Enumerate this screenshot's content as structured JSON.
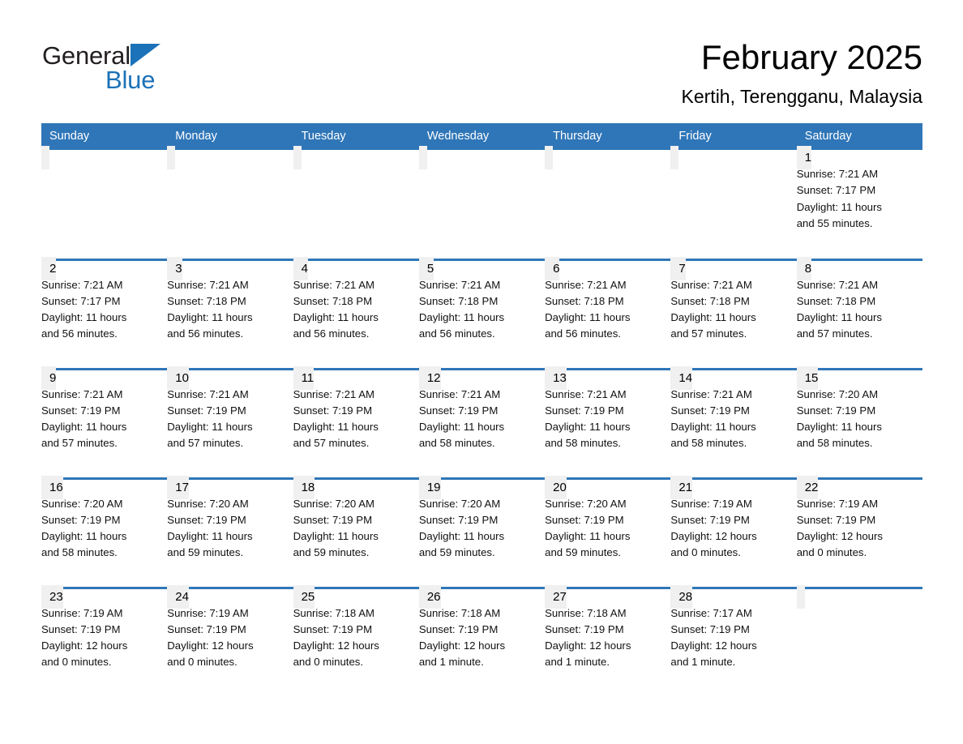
{
  "brand": {
    "name_dark": "General",
    "name_light": "Blue",
    "triangle_color": "#1b72b8"
  },
  "header": {
    "title": "February 2025",
    "subtitle": "Kertih, Terengganu, Malaysia"
  },
  "theme": {
    "header_blue": "#2f76b8",
    "daynum_gray": "#f0f0f0",
    "text_black": "#000000"
  },
  "calendar": {
    "weekday_headers": [
      "Sunday",
      "Monday",
      "Tuesday",
      "Wednesday",
      "Thursday",
      "Friday",
      "Saturday"
    ],
    "weeks": [
      [
        {
          "day": "",
          "sunrise": "",
          "sunset": "",
          "daylight": "",
          "daylight2": ""
        },
        {
          "day": "",
          "sunrise": "",
          "sunset": "",
          "daylight": "",
          "daylight2": ""
        },
        {
          "day": "",
          "sunrise": "",
          "sunset": "",
          "daylight": "",
          "daylight2": ""
        },
        {
          "day": "",
          "sunrise": "",
          "sunset": "",
          "daylight": "",
          "daylight2": ""
        },
        {
          "day": "",
          "sunrise": "",
          "sunset": "",
          "daylight": "",
          "daylight2": ""
        },
        {
          "day": "",
          "sunrise": "",
          "sunset": "",
          "daylight": "",
          "daylight2": ""
        },
        {
          "day": "1",
          "sunrise": "Sunrise: 7:21 AM",
          "sunset": "Sunset: 7:17 PM",
          "daylight": "Daylight: 11 hours",
          "daylight2": "and 55 minutes."
        }
      ],
      [
        {
          "day": "2",
          "sunrise": "Sunrise: 7:21 AM",
          "sunset": "Sunset: 7:17 PM",
          "daylight": "Daylight: 11 hours",
          "daylight2": "and 56 minutes."
        },
        {
          "day": "3",
          "sunrise": "Sunrise: 7:21 AM",
          "sunset": "Sunset: 7:18 PM",
          "daylight": "Daylight: 11 hours",
          "daylight2": "and 56 minutes."
        },
        {
          "day": "4",
          "sunrise": "Sunrise: 7:21 AM",
          "sunset": "Sunset: 7:18 PM",
          "daylight": "Daylight: 11 hours",
          "daylight2": "and 56 minutes."
        },
        {
          "day": "5",
          "sunrise": "Sunrise: 7:21 AM",
          "sunset": "Sunset: 7:18 PM",
          "daylight": "Daylight: 11 hours",
          "daylight2": "and 56 minutes."
        },
        {
          "day": "6",
          "sunrise": "Sunrise: 7:21 AM",
          "sunset": "Sunset: 7:18 PM",
          "daylight": "Daylight: 11 hours",
          "daylight2": "and 56 minutes."
        },
        {
          "day": "7",
          "sunrise": "Sunrise: 7:21 AM",
          "sunset": "Sunset: 7:18 PM",
          "daylight": "Daylight: 11 hours",
          "daylight2": "and 57 minutes."
        },
        {
          "day": "8",
          "sunrise": "Sunrise: 7:21 AM",
          "sunset": "Sunset: 7:18 PM",
          "daylight": "Daylight: 11 hours",
          "daylight2": "and 57 minutes."
        }
      ],
      [
        {
          "day": "9",
          "sunrise": "Sunrise: 7:21 AM",
          "sunset": "Sunset: 7:19 PM",
          "daylight": "Daylight: 11 hours",
          "daylight2": "and 57 minutes."
        },
        {
          "day": "10",
          "sunrise": "Sunrise: 7:21 AM",
          "sunset": "Sunset: 7:19 PM",
          "daylight": "Daylight: 11 hours",
          "daylight2": "and 57 minutes."
        },
        {
          "day": "11",
          "sunrise": "Sunrise: 7:21 AM",
          "sunset": "Sunset: 7:19 PM",
          "daylight": "Daylight: 11 hours",
          "daylight2": "and 57 minutes."
        },
        {
          "day": "12",
          "sunrise": "Sunrise: 7:21 AM",
          "sunset": "Sunset: 7:19 PM",
          "daylight": "Daylight: 11 hours",
          "daylight2": "and 58 minutes."
        },
        {
          "day": "13",
          "sunrise": "Sunrise: 7:21 AM",
          "sunset": "Sunset: 7:19 PM",
          "daylight": "Daylight: 11 hours",
          "daylight2": "and 58 minutes."
        },
        {
          "day": "14",
          "sunrise": "Sunrise: 7:21 AM",
          "sunset": "Sunset: 7:19 PM",
          "daylight": "Daylight: 11 hours",
          "daylight2": "and 58 minutes."
        },
        {
          "day": "15",
          "sunrise": "Sunrise: 7:20 AM",
          "sunset": "Sunset: 7:19 PM",
          "daylight": "Daylight: 11 hours",
          "daylight2": "and 58 minutes."
        }
      ],
      [
        {
          "day": "16",
          "sunrise": "Sunrise: 7:20 AM",
          "sunset": "Sunset: 7:19 PM",
          "daylight": "Daylight: 11 hours",
          "daylight2": "and 58 minutes."
        },
        {
          "day": "17",
          "sunrise": "Sunrise: 7:20 AM",
          "sunset": "Sunset: 7:19 PM",
          "daylight": "Daylight: 11 hours",
          "daylight2": "and 59 minutes."
        },
        {
          "day": "18",
          "sunrise": "Sunrise: 7:20 AM",
          "sunset": "Sunset: 7:19 PM",
          "daylight": "Daylight: 11 hours",
          "daylight2": "and 59 minutes."
        },
        {
          "day": "19",
          "sunrise": "Sunrise: 7:20 AM",
          "sunset": "Sunset: 7:19 PM",
          "daylight": "Daylight: 11 hours",
          "daylight2": "and 59 minutes."
        },
        {
          "day": "20",
          "sunrise": "Sunrise: 7:20 AM",
          "sunset": "Sunset: 7:19 PM",
          "daylight": "Daylight: 11 hours",
          "daylight2": "and 59 minutes."
        },
        {
          "day": "21",
          "sunrise": "Sunrise: 7:19 AM",
          "sunset": "Sunset: 7:19 PM",
          "daylight": "Daylight: 12 hours",
          "daylight2": "and 0 minutes."
        },
        {
          "day": "22",
          "sunrise": "Sunrise: 7:19 AM",
          "sunset": "Sunset: 7:19 PM",
          "daylight": "Daylight: 12 hours",
          "daylight2": "and 0 minutes."
        }
      ],
      [
        {
          "day": "23",
          "sunrise": "Sunrise: 7:19 AM",
          "sunset": "Sunset: 7:19 PM",
          "daylight": "Daylight: 12 hours",
          "daylight2": "and 0 minutes."
        },
        {
          "day": "24",
          "sunrise": "Sunrise: 7:19 AM",
          "sunset": "Sunset: 7:19 PM",
          "daylight": "Daylight: 12 hours",
          "daylight2": "and 0 minutes."
        },
        {
          "day": "25",
          "sunrise": "Sunrise: 7:18 AM",
          "sunset": "Sunset: 7:19 PM",
          "daylight": "Daylight: 12 hours",
          "daylight2": "and 0 minutes."
        },
        {
          "day": "26",
          "sunrise": "Sunrise: 7:18 AM",
          "sunset": "Sunset: 7:19 PM",
          "daylight": "Daylight: 12 hours",
          "daylight2": "and 1 minute."
        },
        {
          "day": "27",
          "sunrise": "Sunrise: 7:18 AM",
          "sunset": "Sunset: 7:19 PM",
          "daylight": "Daylight: 12 hours",
          "daylight2": "and 1 minute."
        },
        {
          "day": "28",
          "sunrise": "Sunrise: 7:17 AM",
          "sunset": "Sunset: 7:19 PM",
          "daylight": "Daylight: 12 hours",
          "daylight2": "and 1 minute."
        },
        {
          "day": "",
          "sunrise": "",
          "sunset": "",
          "daylight": "",
          "daylight2": ""
        }
      ]
    ]
  }
}
